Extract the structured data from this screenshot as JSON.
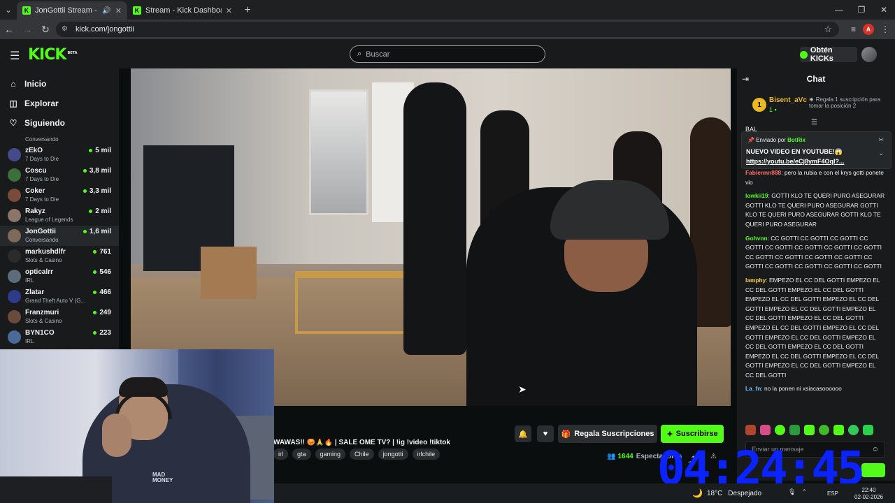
{
  "browser": {
    "tabs": [
      {
        "title": "JonGottii Stream - Watch L",
        "active": true,
        "audio": true
      },
      {
        "title": "Stream - Kick Dashboard",
        "active": false,
        "audio": false
      }
    ],
    "url": "kick.com/jongottii",
    "profile_initial": "A"
  },
  "header": {
    "logo": "KICK",
    "logo_badge": "BETA",
    "search_placeholder": "Buscar",
    "kicks_label": "Obtén KICKs"
  },
  "sidebar": {
    "nav": [
      {
        "label": "Inicio",
        "icon": "home-icon"
      },
      {
        "label": "Explorar",
        "icon": "compass-icon"
      },
      {
        "label": "Siguiendo",
        "icon": "heart-icon"
      }
    ],
    "partial_category": "Conversando",
    "channels": [
      {
        "name": "zEkO",
        "category": "7 Days to Die",
        "viewers": "5 mil",
        "avatar": "#444a8a"
      },
      {
        "name": "Coscu",
        "category": "7 Days to Die",
        "viewers": "3,8 mil",
        "avatar": "#3d6f3a"
      },
      {
        "name": "Coker",
        "category": "7 Days to Die",
        "viewers": "3,3 mil",
        "avatar": "#7a4b3a"
      },
      {
        "name": "Rakyz",
        "category": "League of Legends",
        "viewers": "2 mil",
        "avatar": "#8c7468"
      },
      {
        "name": "JonGottii",
        "category": "Conversando",
        "viewers": "1,6 mil",
        "avatar": "#7e6a5a",
        "highlight": true
      },
      {
        "name": "markushdlfr",
        "category": "Slots & Casino",
        "viewers": "761",
        "avatar": "#2b2b2b"
      },
      {
        "name": "opticalrr",
        "category": "IRL",
        "viewers": "546",
        "avatar": "#5c6c7a"
      },
      {
        "name": "Zlatar",
        "category": "Grand Theft Auto V (G...",
        "viewers": "466",
        "avatar": "#2e3b8a"
      },
      {
        "name": "Franzmuri",
        "category": "Slots & Casino",
        "viewers": "249",
        "avatar": "#6a4a3a"
      },
      {
        "name": "BYN1CO",
        "category": "IRL",
        "viewers": "223",
        "avatar": "#4a6a9a"
      }
    ]
  },
  "stream": {
    "title": "WAWAS!! 😡🙏🔥 | SALE OME TV? | !ig !video !tiktok",
    "tags": [
      "irl",
      "gta",
      "gaming",
      "Chile",
      "jongotti",
      "irlchile"
    ],
    "viewers": "1644",
    "viewers_label": "Espectadores",
    "gift_label": "Regala Suscripciones",
    "subscribe_label": "Suscribirse"
  },
  "chat": {
    "title": "Chat",
    "leader": {
      "rank": "1",
      "name": "Bisent_aVc",
      "count": "1"
    },
    "gift_note": "Regala 1 suscripción para tomar la posición 2",
    "partial_line": "BAL",
    "pinned": {
      "by_prefix": "Enviado por",
      "by_user": "BotRix",
      "message": "NUEVO VIDEO EN YOUTUBE!😱",
      "link": "https://youtu.be/eCj8ymF4OqI?..."
    },
    "messages": [
      {
        "user": "Fabiennn888",
        "color": "#ff6b6b",
        "text": "pero la rubia e con el krys gotti ponete vio"
      },
      {
        "user": "lowkii19",
        "color": "#53fc18",
        "text": "GOTTI KLO TE QUERI PURO ASEGURAR GOTTI KLO TE QUERI PURO ASEGURAR GOTTI KLO TE QUERI PURO ASEGURAR GOTTI KLO TE QUERI PURO ASEGURAR"
      },
      {
        "user": "Gohvnn",
        "color": "#53fc18",
        "text": "CC GOTTI CC GOTTI CC GOTTI CC GOTTI CC GOTTI CC GOTTI CC GOTTI CC GOTTI CC GOTTI CC GOTTI CC GOTTI CC GOTTI CC GOTTI CC GOTTI CC GOTTI CC GOTTI CC GOTTI"
      },
      {
        "user": "lamphy",
        "color": "#ffd43b",
        "text": "EMPEZO EL CC DEL GOTTI EMPEZO EL CC DEL GOTTI EMPEZO EL CC DEL GOTTI EMPEZO EL CC DEL GOTTI EMPEZO EL CC DEL GOTTI EMPEZO EL CC DEL GOTTI EMPEZO EL CC DEL GOTTI EMPEZO EL CC DEL GOTTI EMPEZO EL CC DEL GOTTI EMPEZO EL CC DEL GOTTI EMPEZO EL CC DEL GOTTI EMPEZO EL CC DEL GOTTI EMPEZO EL CC DEL GOTTI EMPEZO EL CC DEL GOTTI EMPEZO EL CC DEL GOTTI EMPEZO EL CC DEL GOTTI EMPEZO EL CC DEL GOTTI"
      },
      {
        "user": "La_fn",
        "color": "#74c0fc",
        "text": "no la ponen ni xsiacasoooooo"
      }
    ],
    "input_placeholder": "Enviar un mensaje"
  },
  "overlay": {
    "clock": "04:24:45",
    "webcam_logo": "MAD\nMONEY"
  },
  "taskbar": {
    "temperature": "18°C",
    "weather": "Despejado",
    "lang": "ESP",
    "time": "22:40",
    "date": "02-02-2026"
  }
}
